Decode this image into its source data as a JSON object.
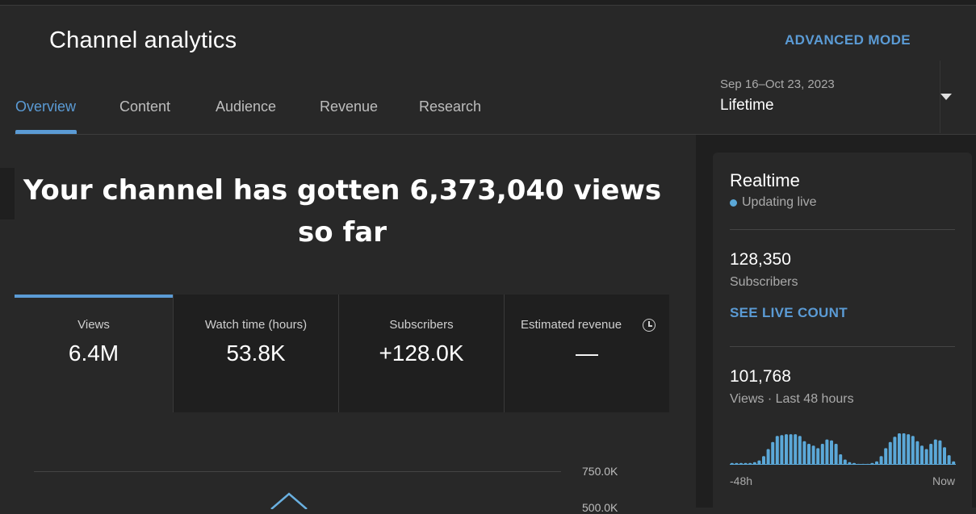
{
  "header": {
    "title": "Channel analytics",
    "advanced_mode": "ADVANCED MODE",
    "tabs": [
      {
        "label": "Overview",
        "active": true
      },
      {
        "label": "Content",
        "active": false
      },
      {
        "label": "Audience",
        "active": false
      },
      {
        "label": "Revenue",
        "active": false
      },
      {
        "label": "Research",
        "active": false
      }
    ],
    "date_range": "Sep 16–Oct 23, 2023",
    "period": "Lifetime"
  },
  "main": {
    "headline": "Your channel has gotten 6,373,040 views so far",
    "metrics": [
      {
        "label": "Views",
        "value": "6.4M",
        "active": true
      },
      {
        "label": "Watch time (hours)",
        "value": "53.8K",
        "active": false
      },
      {
        "label": "Subscribers",
        "value": "+128.0K",
        "active": false
      },
      {
        "label": "Estimated revenue",
        "value": "—",
        "active": false,
        "icon": "clock-icon"
      }
    ],
    "chart": {
      "ticks": [
        "750.0K",
        "500.0K"
      ]
    }
  },
  "realtime": {
    "title": "Realtime",
    "status": "Updating live",
    "subscribers_value": "128,350",
    "subscribers_label": "Subscribers",
    "see_live": "SEE LIVE COUNT",
    "views_value": "101,768",
    "views_label": "Views · Last 48 hours",
    "axis_start": "-48h",
    "axis_end": "Now",
    "bars": [
      2,
      2,
      2,
      2,
      2,
      3,
      5,
      10,
      18,
      26,
      33,
      34,
      35,
      35,
      35,
      33,
      27,
      24,
      22,
      19,
      24,
      29,
      28,
      24,
      12,
      6,
      3,
      2,
      1,
      1,
      1,
      2,
      4,
      10,
      19,
      26,
      32,
      36,
      36,
      35,
      33,
      27,
      22,
      18,
      24,
      29,
      28,
      20,
      11,
      4
    ],
    "accent": "#5ba8d8"
  },
  "colors": {
    "accent": "#5b9bd5",
    "background": "#282828",
    "panel": "#1f1f1f"
  }
}
